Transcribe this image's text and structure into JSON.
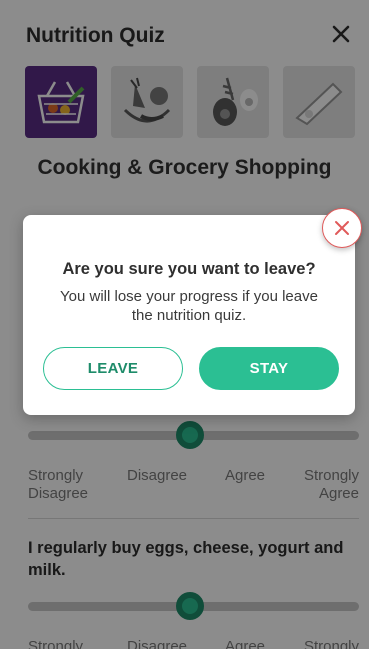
{
  "header": {
    "title": "Nutrition Quiz"
  },
  "icons": {
    "close": "close-icon",
    "tiles": [
      "grocery-basket-icon",
      "fruit-vegetable-icon",
      "avocado-egg-icon",
      "cheese-icon"
    ]
  },
  "section": {
    "title": "Cooking & Grocery Shopping"
  },
  "scale": {
    "strongly_disagree": "Strongly Disagree",
    "disagree": "Disagree",
    "agree": "Agree",
    "strongly_agree": "Strongly Agree"
  },
  "questions": [
    {
      "text": "I regularly buy eggs, cheese, yogurt and milk."
    }
  ],
  "modal": {
    "title": "Are you sure you want to leave?",
    "body": "You will lose your progress if you leave the nutrition quiz.",
    "leave_label": "LEAVE",
    "stay_label": "STAY"
  },
  "colors": {
    "accent": "#2bbf93",
    "accent_dark": "#1e8c6a",
    "tile_active": "#5a2d86",
    "close_red": "#e05a5a"
  }
}
